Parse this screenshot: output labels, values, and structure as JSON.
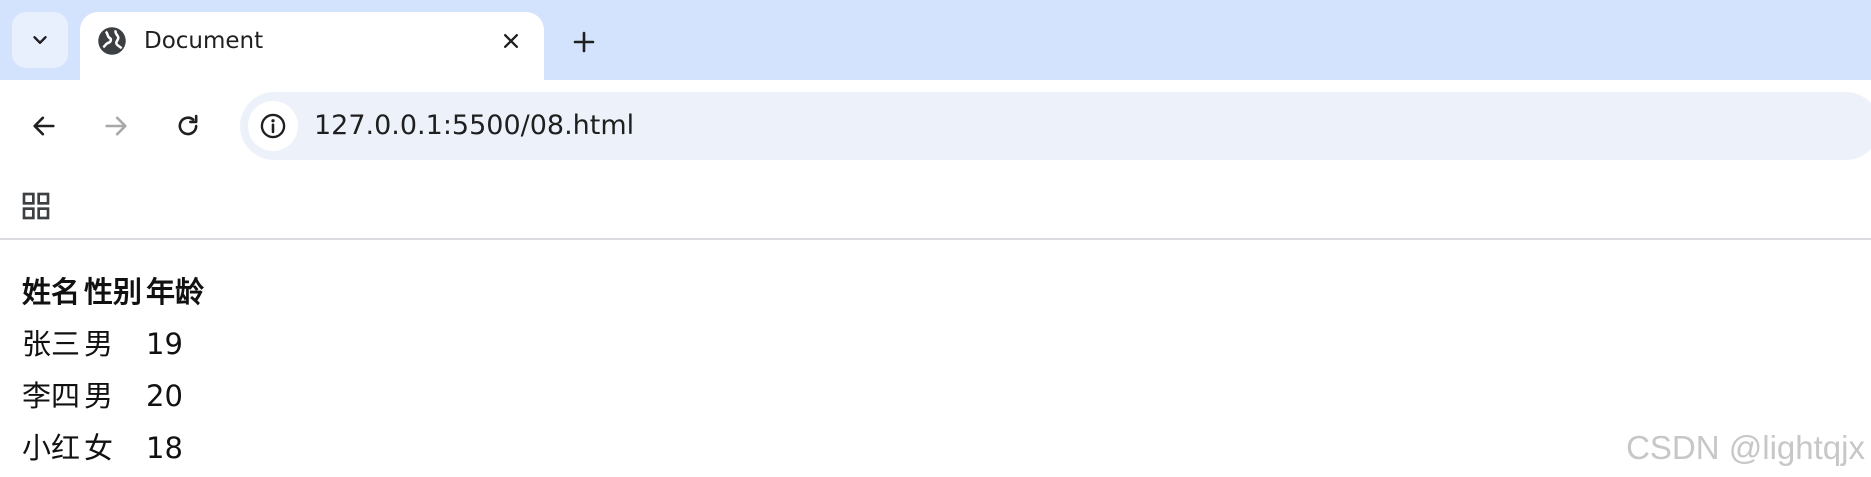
{
  "browser": {
    "tab": {
      "title": "Document",
      "favicon": "globe-icon"
    },
    "address_bar": {
      "url": "127.0.0.1:5500/08.html"
    },
    "icons": {
      "tab_search": "chevron-down-icon",
      "close_tab": "close-icon",
      "new_tab": "plus-icon",
      "back": "arrow-left-icon",
      "forward": "arrow-right-icon",
      "reload": "reload-icon",
      "site_info": "info-icon",
      "apps": "apps-grid-icon"
    },
    "colors": {
      "tabstrip_bg": "#d3e3fd",
      "omnibox_bg": "#edf2fa",
      "forward_disabled": "#a8a8a8"
    }
  },
  "page": {
    "table": {
      "headers": [
        "姓名",
        "性别",
        "年龄"
      ],
      "rows": [
        [
          "张三",
          "男",
          "19"
        ],
        [
          "李四",
          "男",
          "20"
        ],
        [
          "小红",
          "女",
          "18"
        ]
      ]
    },
    "watermark": "CSDN @lightqjx"
  }
}
